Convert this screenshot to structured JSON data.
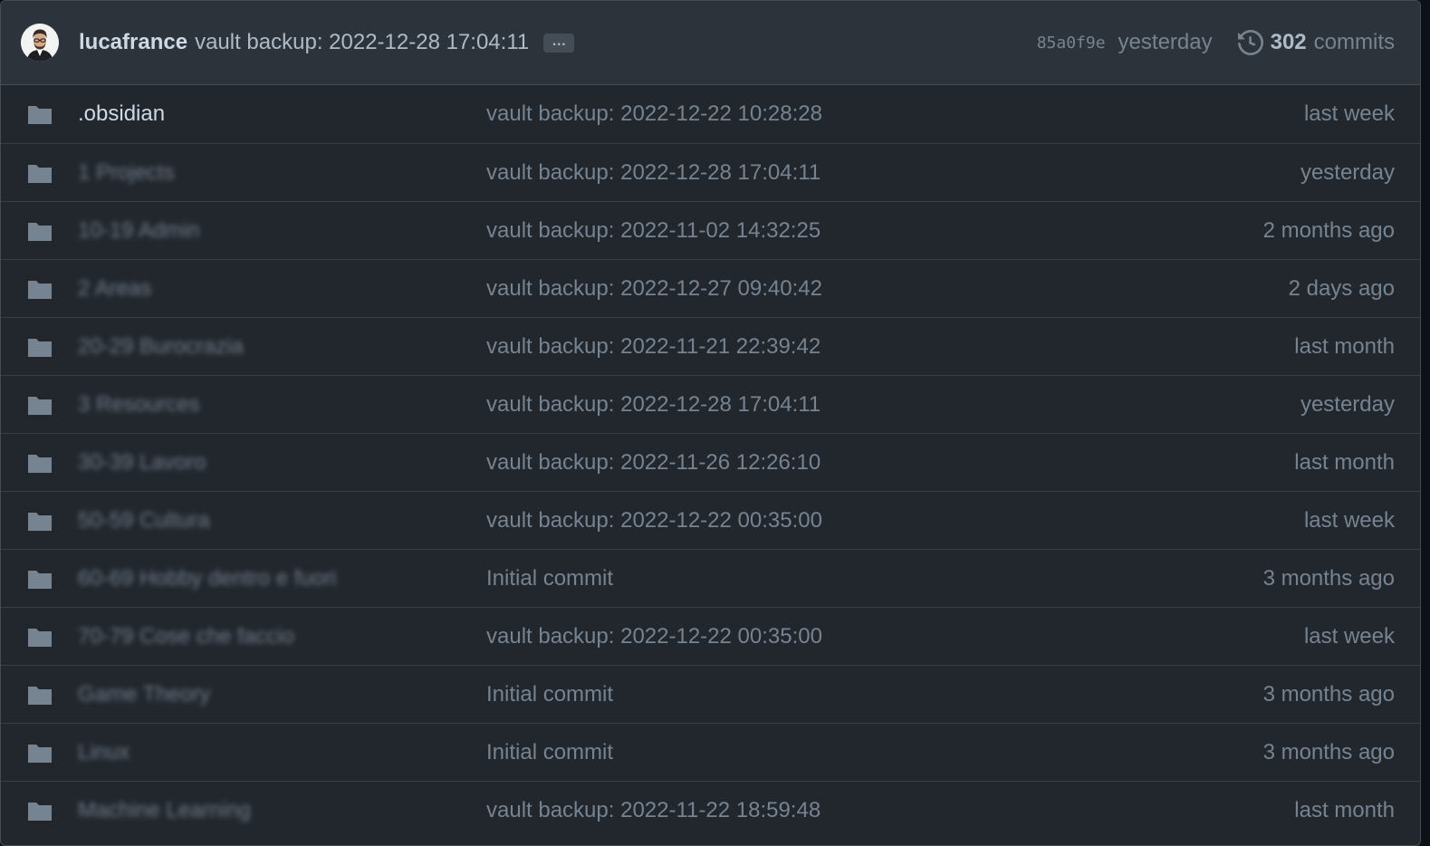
{
  "header": {
    "author": "lucafrance",
    "message": "vault backup: 2022-12-28 17:04:11",
    "ellipsis": "…",
    "sha": "85a0f9e",
    "when": "yesterday",
    "commit_count": "302",
    "commits_label": "commits"
  },
  "rows": [
    {
      "name": ".obsidian",
      "blurred": false,
      "message": "vault backup: 2022-12-22 10:28:28",
      "age": "last week"
    },
    {
      "name": "1 Projects",
      "blurred": true,
      "message": "vault backup: 2022-12-28 17:04:11",
      "age": "yesterday"
    },
    {
      "name": "10-19 Admin",
      "blurred": true,
      "message": "vault backup: 2022-11-02 14:32:25",
      "age": "2 months ago"
    },
    {
      "name": "2 Areas",
      "blurred": true,
      "message": "vault backup: 2022-12-27 09:40:42",
      "age": "2 days ago"
    },
    {
      "name": "20-29 Burocrazia",
      "blurred": true,
      "message": "vault backup: 2022-11-21 22:39:42",
      "age": "last month"
    },
    {
      "name": "3 Resources",
      "blurred": true,
      "message": "vault backup: 2022-12-28 17:04:11",
      "age": "yesterday"
    },
    {
      "name": "30-39 Lavoro",
      "blurred": true,
      "message": "vault backup: 2022-11-26 12:26:10",
      "age": "last month"
    },
    {
      "name": "50-59 Cultura",
      "blurred": true,
      "message": "vault backup: 2022-12-22 00:35:00",
      "age": "last week"
    },
    {
      "name": "60-69 Hobby dentro e fuori",
      "blurred": true,
      "message": "Initial commit",
      "age": "3 months ago"
    },
    {
      "name": "70-79 Cose che faccio",
      "blurred": true,
      "message": "vault backup: 2022-12-22 00:35:00",
      "age": "last week"
    },
    {
      "name": "Game Theory",
      "blurred": true,
      "message": "Initial commit",
      "age": "3 months ago"
    },
    {
      "name": "Linux",
      "blurred": true,
      "message": "Initial commit",
      "age": "3 months ago"
    },
    {
      "name": "Machine Learning",
      "blurred": true,
      "message": "vault backup: 2022-11-22 18:59:48",
      "age": "last month"
    }
  ],
  "colors": {
    "folder": "#768390",
    "background": "#22272e",
    "header_background": "#2d333b"
  }
}
